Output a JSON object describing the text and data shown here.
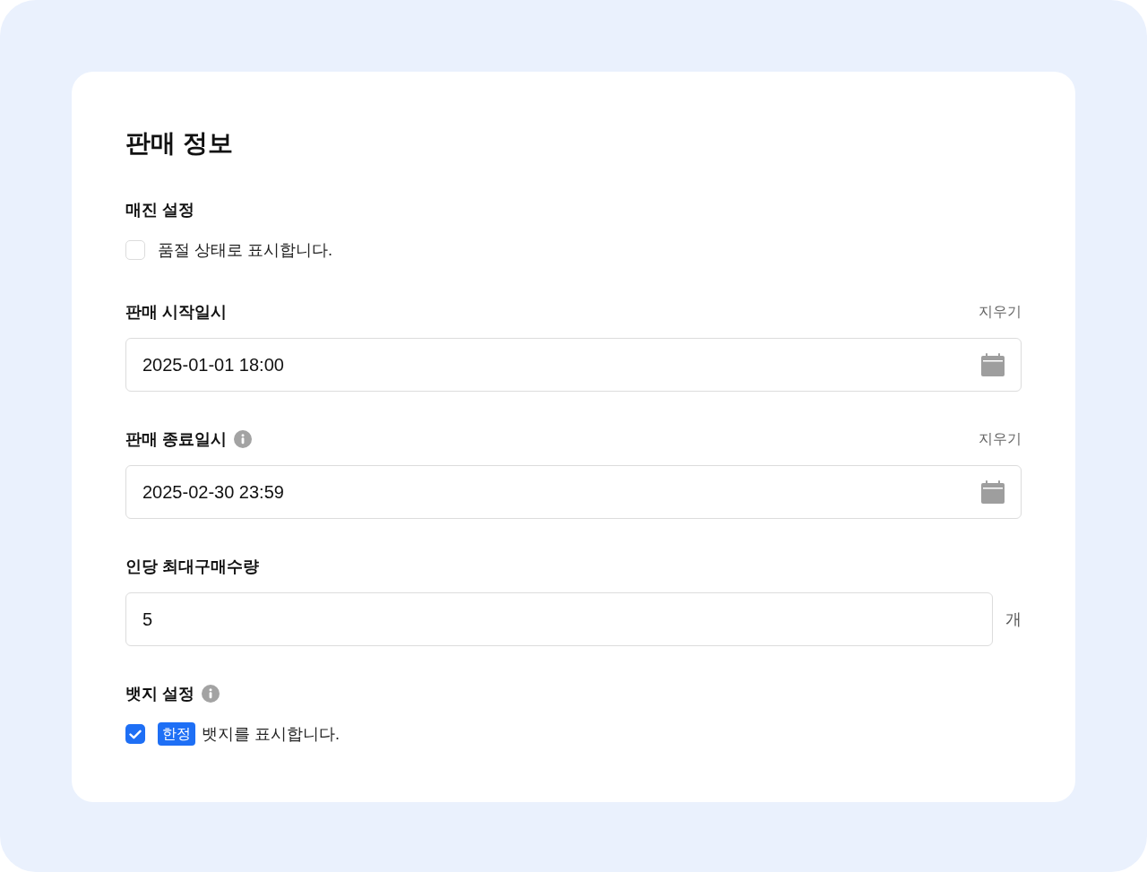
{
  "title": "판매 정보",
  "sections": [
    {
      "kind": "checkbox",
      "label": "매진 설정",
      "info": false,
      "checkbox": {
        "label": "품절 상태로 표시합니다.",
        "checked": false
      }
    },
    {
      "kind": "datetime",
      "label": "판매 시작일시",
      "info": false,
      "clear": "지우기",
      "value": "2025-01-01 18:00"
    },
    {
      "kind": "datetime",
      "label": "판매 종료일시",
      "info": true,
      "clear": "지우기",
      "value": "2025-02-30 23:59"
    },
    {
      "kind": "number",
      "label": "인당 최대구매수량",
      "info": false,
      "value": "5",
      "unit": "개"
    },
    {
      "kind": "checkbox",
      "label": "뱃지 설정",
      "info": true,
      "checkbox": {
        "badge": "한정",
        "label": "뱃지를 표시합니다.",
        "checked": true
      }
    }
  ]
}
